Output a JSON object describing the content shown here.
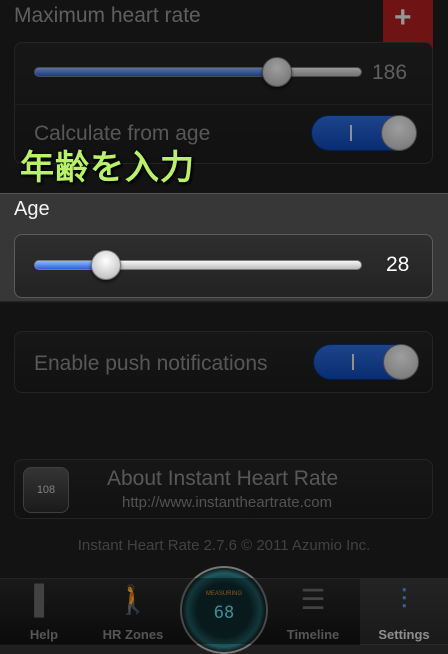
{
  "max_hr": {
    "title": "Maximum heart rate",
    "value": "186",
    "fraction": 0.74
  },
  "calc_from_age": {
    "label": "Calculate from age",
    "on": true,
    "on_glyph": "|"
  },
  "annotation": {
    "text": "年齢を入力"
  },
  "age": {
    "label": "Age",
    "value": "28",
    "fraction": 0.22
  },
  "push": {
    "label": "Enable push notifications",
    "on": true,
    "on_glyph": "|"
  },
  "about": {
    "title": "About Instant Heart Rate",
    "url": "http://www.instantheartrate.com",
    "icon_text": "108"
  },
  "bookmark": {
    "icon": "plus-icon",
    "glyph": "+",
    "color": "#b51f23"
  },
  "footer": {
    "copyright": "Instant Heart Rate 2.7.6 © 2011 Azumio Inc."
  },
  "tabbar": {
    "tabs": [
      {
        "label": "Help",
        "icon": "book-icon",
        "glyph": "▌"
      },
      {
        "label": "HR Zones",
        "icon": "walking-person-icon",
        "glyph": "🚶"
      },
      {
        "label": "Timeline",
        "icon": "list-icon",
        "glyph": "☰"
      },
      {
        "label": "Settings",
        "icon": "sliders-icon",
        "glyph": "⫶",
        "active": true
      }
    ],
    "center": {
      "top_text": "MEASURING",
      "value": "68",
      "icon": "heart-monitor-icon"
    }
  },
  "colors": {
    "accent": "#2f6fe0",
    "annotation": "#b9f26a",
    "bookmark": "#b51f23"
  }
}
